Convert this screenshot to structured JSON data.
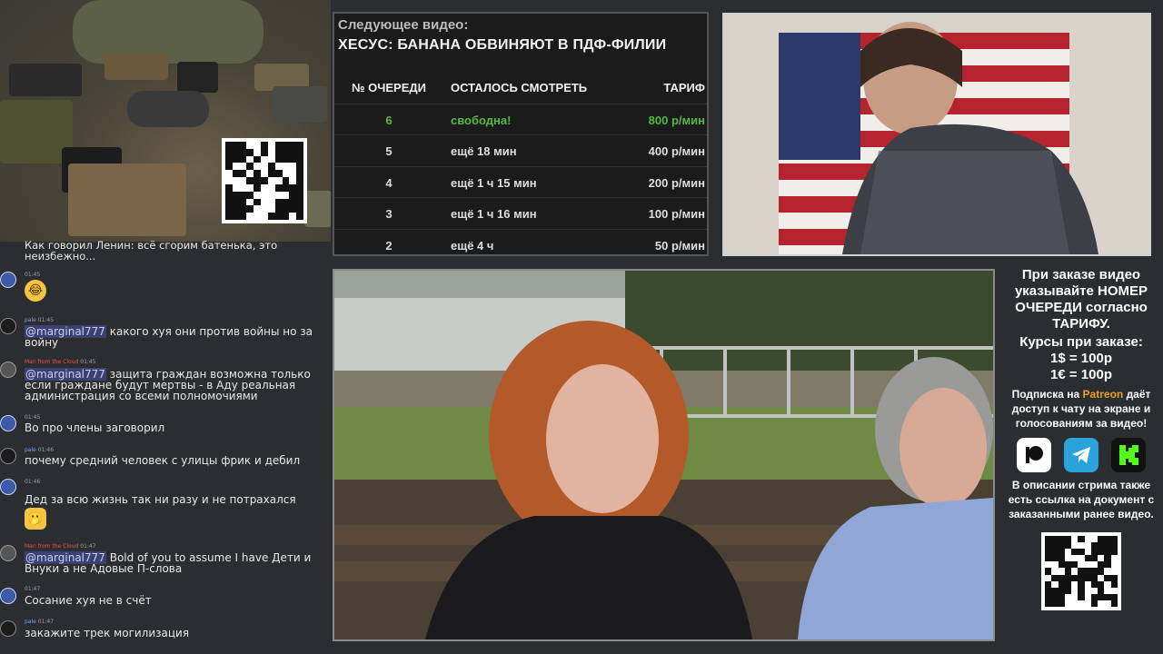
{
  "promo": {
    "icon": "qr-code-icon"
  },
  "chat": {
    "messages": [
      {
        "name": "",
        "time": "",
        "text": "Как говорил Ленин:  всё сгорим батенька, это неизбежно..."
      },
      {
        "name": "",
        "time": "01:45",
        "text": "",
        "emoji": "😂"
      },
      {
        "name": "pale",
        "time": "01:45",
        "mention": "@marginal777",
        "text": " какого хуя они против войны но за войну"
      },
      {
        "name": "Man from the Cloud",
        "time": "01:45",
        "mention": "@marginal777",
        "text": " защита граждан возможна только если граждане будут мертвы - в Аду реальная администрация со всеми полномочиями"
      },
      {
        "name": "",
        "time": "01:45",
        "text": "Во про члены заговорил"
      },
      {
        "name": "pale",
        "time": "01:46",
        "text": "почему средний человек с улицы фрик и дебил"
      },
      {
        "name": "",
        "time": "01:46",
        "text": "Дед за всю жизнь так ни разу и не потрахался",
        "emoji": "🫢"
      },
      {
        "name": "Man from the Cloud",
        "time": "01:47",
        "mention": "@marginal777",
        "text": " Bold of you to assume I have Дети и Внуки а не Адовые П-слова"
      },
      {
        "name": "",
        "time": "01:47",
        "text": "Сосание хуя не в счёт"
      },
      {
        "name": "pale",
        "time": "01:47",
        "text": "закажите трек могилизация"
      }
    ]
  },
  "queue": {
    "heading": "Следующее видео:",
    "title": "ХЕСУС: БАНАНА ОБВИНЯЮТ В ПДФ-ФИЛИИ",
    "columns": [
      "№ ОЧЕРЕДИ",
      "ОСТАЛОСЬ СМОТРЕТЬ",
      "ТАРИФ"
    ],
    "rows": [
      {
        "num": "6",
        "remaining": "свободна!",
        "rate": "800 р/мин"
      },
      {
        "num": "5",
        "remaining": "ещё 18 мин",
        "rate": "400 р/мин"
      },
      {
        "num": "4",
        "remaining": "ещё 1 ч 15 мин",
        "rate": "200 р/мин"
      },
      {
        "num": "3",
        "remaining": "ещё 1 ч 16 мин",
        "rate": "100 р/мин"
      },
      {
        "num": "2",
        "remaining": "ещё 4 ч",
        "rate": "50 р/мин"
      }
    ]
  },
  "info": {
    "order_note": "При заказе видео указывайте НОМЕР ОЧЕРЕДИ согласно ТАРИФУ.",
    "rates_title": "Курсы при заказе:",
    "usd_rate": "1$ = 100р",
    "eur_rate": "1€ = 100р",
    "sub_pre": "Подписка на ",
    "sub_link": "Patreon",
    "sub_post": " даёт доступ к чату на экране и голосованиям за видео!",
    "social": [
      {
        "icon": "patreon-icon",
        "color": "#ffffff"
      },
      {
        "icon": "telegram-icon",
        "color": "#2aa3dd"
      },
      {
        "icon": "kick-icon",
        "color": "#53fc18"
      }
    ],
    "doc_note": "В описании стрима также есть ссылка на документ с заказанными ранее видео."
  }
}
